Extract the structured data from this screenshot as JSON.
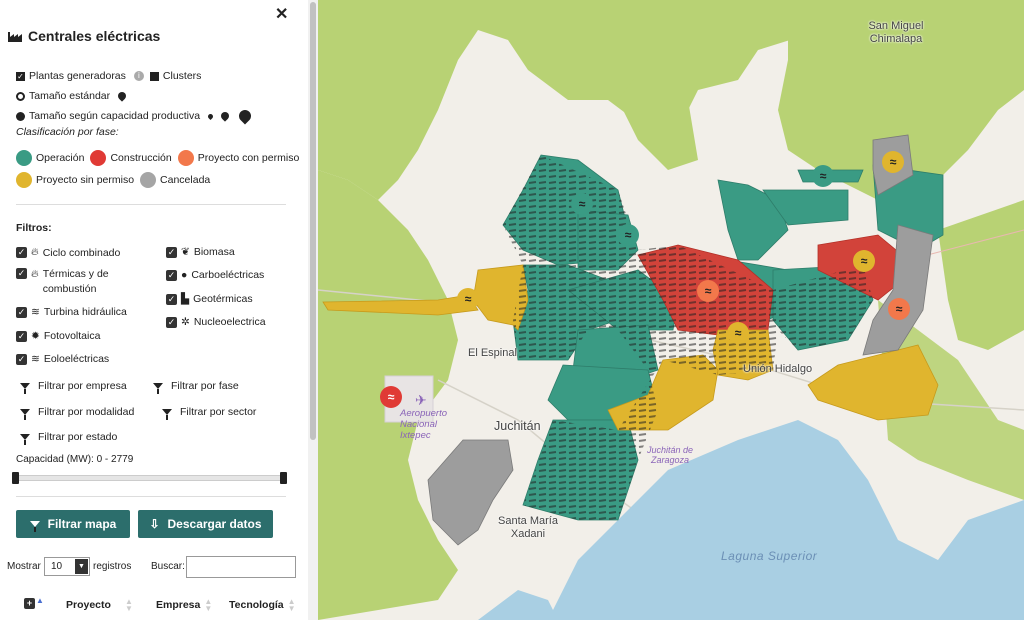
{
  "sidebar": {
    "title": "Centrales eléctricas",
    "plantas_label": "Plantas generadoras",
    "clusters_label": "Clusters",
    "tamano_estandar": "Tamaño estándar",
    "tamano_capacidad": "Tamaño según capacidad productiva",
    "clasificacion": "Clasificación por fase:",
    "phases": [
      {
        "label": "Operación",
        "color": "#3a9b84"
      },
      {
        "label": "Construcción",
        "color": "#e03a35"
      },
      {
        "label": "Proyecto con permiso",
        "color": "#f2784b"
      },
      {
        "label": "Proyecto sin permiso",
        "color": "#e0b52e"
      },
      {
        "label": "Cancelada",
        "color": "#a5a5a5"
      }
    ],
    "filtros_label": "Filtros:",
    "filter_types_left": [
      "Ciclo combinado",
      "Térmicas y de combustión",
      "Turbina hidráulica",
      "Fotovoltaica",
      "Eoloeléctricas"
    ],
    "filter_types_right": [
      "Biomasa",
      "Carboeléctricas",
      "Geotérmicas",
      "Nucleoelectrica"
    ],
    "filter_links": [
      "Filtrar por empresa",
      "Filtrar por fase",
      "Filtrar por modalidad",
      "Filtrar por sector",
      "Filtrar por estado"
    ],
    "capacidad_label": "Capacidad (MW): 0 - 2779",
    "capacidad_min": 0,
    "capacidad_max": 2779,
    "btn_filtrar": "Filtrar mapa",
    "btn_descargar": "Descargar datos",
    "mostrar_label": "Mostrar",
    "mostrar_value": "10",
    "registros_label": "registros",
    "buscar_label": "Buscar:",
    "table_headers": [
      "Proyecto",
      "Empresa",
      "Tecnología"
    ]
  },
  "map": {
    "places": [
      "San Miguel Chimalapa",
      "El Espinal",
      "Juchitán",
      "Unión Hidalgo",
      "Santa María Xadani",
      "Juchitán de Zaragoza",
      "Laguna Superior",
      "Aeropuerto Nacional Ixtepec"
    ],
    "colors": {
      "land": "#f2efe9",
      "green": "#b8d274",
      "water": "#a9cfe3",
      "operacion": "#3a9b84",
      "construccion": "#d2433a",
      "sin_permiso": "#e0b52e",
      "cancelada": "#9d9d9d"
    }
  }
}
